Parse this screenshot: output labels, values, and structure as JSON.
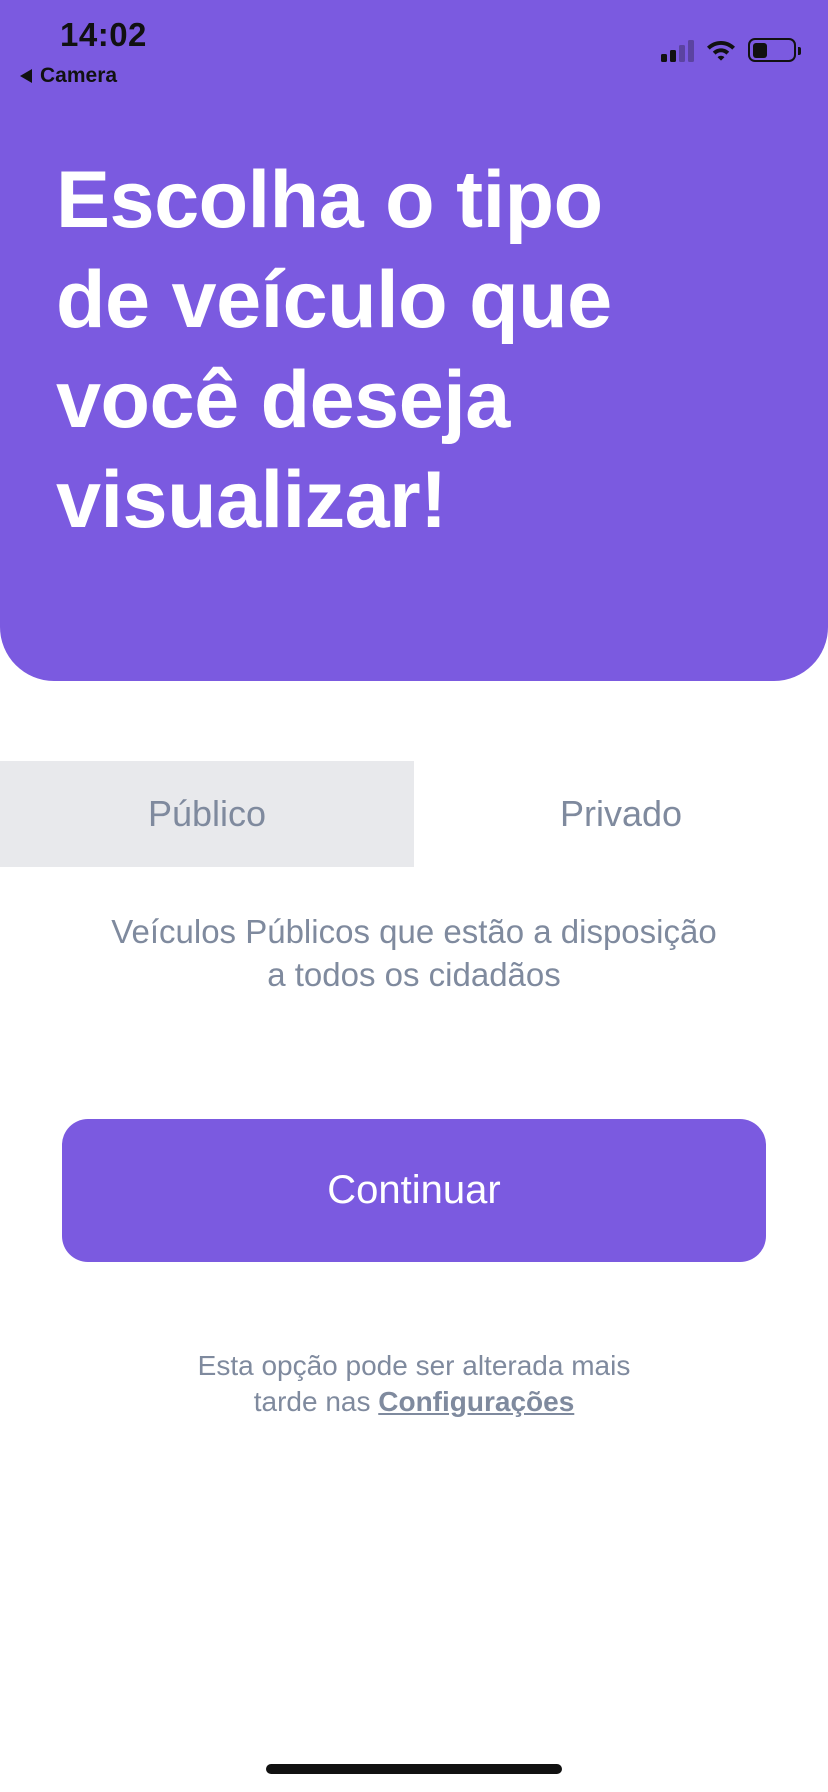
{
  "status_bar": {
    "time": "14:02",
    "back_app_label": "Camera",
    "icons": [
      "signal-icon",
      "wifi-icon",
      "battery-icon"
    ]
  },
  "header": {
    "title_lines": [
      "Escolha o tipo",
      "de veículo que",
      "você deseja",
      "visualizar!"
    ]
  },
  "tabs": {
    "items": [
      {
        "label": "Público",
        "selected": true
      },
      {
        "label": "Privado",
        "selected": false
      }
    ]
  },
  "description": {
    "lines": [
      "Veículos Públicos que estão a disposição",
      "a todos os cidadãos"
    ]
  },
  "continue_button": {
    "label": "Continuar"
  },
  "footnote": {
    "line1": "Esta opção pode ser alterada mais",
    "line2_prefix": "tarde nas ",
    "link_label": "Configurações"
  },
  "colors": {
    "accent": "#7B5AE0",
    "muted_text": "#7F8A9E",
    "tab_selected_bg": "#E8E9EC",
    "header_text": "#FFFFFF"
  }
}
